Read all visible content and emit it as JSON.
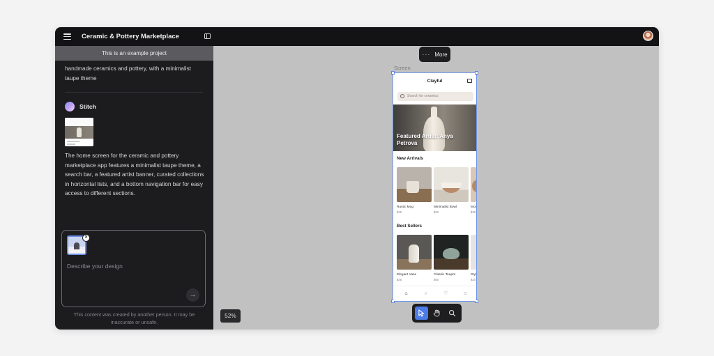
{
  "app": {
    "title": "Ceramic & Pottery Marketplace"
  },
  "left_panel": {
    "banner": "This is an example project",
    "previous_message_tail": "handmade ceramics and pottery, with a minimalist taupe theme",
    "assistant_name": "Stitch",
    "response": "The home screen for the ceramic and pottery marketplace app features a minimalist taupe theme, a search bar, a featured artist banner, curated collections in horizontal lists, and a bottom navigation bar for easy access to different sections.",
    "prompt": {
      "placeholder": "Describe your design",
      "value": ""
    },
    "disclaimer": "This content was created by another person. It may be inaccurate or unsafe."
  },
  "canvas": {
    "more_label": "More",
    "screen_label": "Screen",
    "zoom": "52%",
    "tools": [
      "select-icon",
      "hand-icon",
      "search-icon"
    ],
    "selection_color": "#5a86e8"
  },
  "phone": {
    "brand": "Clayful",
    "search_placeholder": "Search for ceramics",
    "hero_text": "Featured Artist: Anya Petrova",
    "new_arrivals": {
      "title": "New Arrivals",
      "items": [
        {
          "name": "Rustic Mug",
          "price": "$25"
        },
        {
          "name": "Minimalist Bowl",
          "price": "$30"
        },
        {
          "name": "Moo",
          "price": "$35"
        }
      ]
    },
    "best_sellers": {
      "title": "Best Sellers",
      "items": [
        {
          "name": "Elegant Vase",
          "price": "$45"
        },
        {
          "name": "Classic Teapot",
          "price": "$60"
        },
        {
          "name": "Styl",
          "price": "$20"
        }
      ]
    },
    "nav": [
      "home-icon",
      "search-icon",
      "heart-icon",
      "profile-icon"
    ]
  }
}
